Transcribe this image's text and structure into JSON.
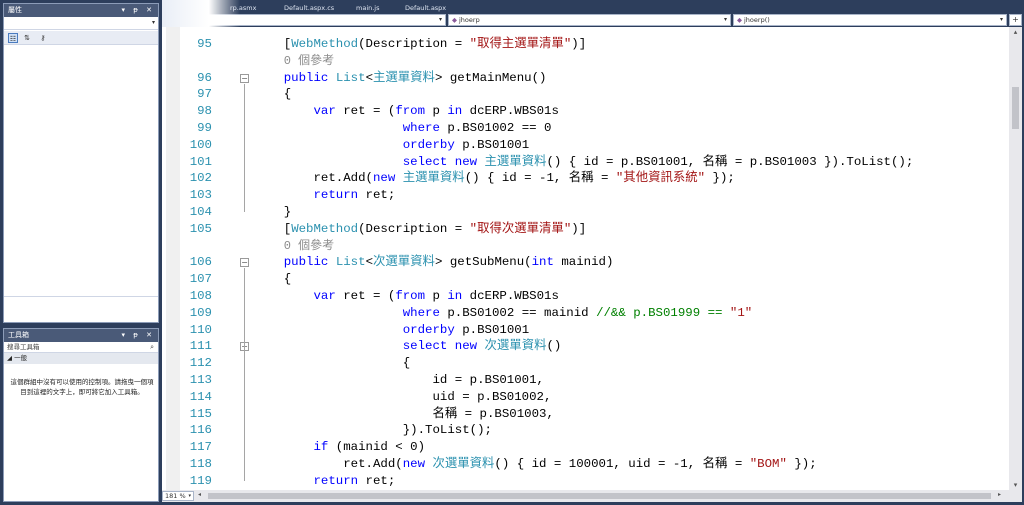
{
  "properties_panel": {
    "title": "屬性",
    "pin_buttons": "▾ ᵽ ✕",
    "toolbar": [
      "categorized-icon",
      "alphabetical-icon",
      "property-pages-icon"
    ]
  },
  "toolbox_panel": {
    "title": "工具箱",
    "pin_buttons": "▾ ᵽ ✕",
    "search_placeholder": "搜尋工具箱",
    "group_label": "◢ 一般",
    "empty_message": "這個群組中沒有可以使用的控制項。請拖曳一個項目到這裡的文字上，即可將它加入工具箱。"
  },
  "tabs": [
    "rp.asmx",
    "Default.aspx.cs",
    "main.js",
    "Default.aspx"
  ],
  "navbar": {
    "project_combo": "",
    "class_combo": "jhoerp",
    "member_combo": "jhoerp()"
  },
  "zoom": "181 %",
  "code_lines": [
    {
      "n": "95",
      "t": "    [<ty>WebMethod</ty>(Description = <str>\"取得主選單清單\"</str>)]"
    },
    {
      "n": "",
      "t": "    <lens>0 個參考</lens>"
    },
    {
      "n": "96",
      "t": "    <kw>public</kw> <ty>List</ty>&lt;<ty>主選單資料</ty>&gt; getMainMenu()"
    },
    {
      "n": "97",
      "t": "    {"
    },
    {
      "n": "98",
      "t": "        <kw>var</kw> ret = (<kw>from</kw> p <kw>in</kw> dcERP.WBS01s"
    },
    {
      "n": "99",
      "t": "                    <kw>where</kw> p.BS01002 == 0"
    },
    {
      "n": "100",
      "t": "                    <kw>orderby</kw> p.BS01001"
    },
    {
      "n": "101",
      "t": "                    <kw>select</kw> <kw>new</kw> <ty>主選單資料</ty>() { id = p.BS01001, 名稱 = p.BS01003 }).ToList();"
    },
    {
      "n": "102",
      "t": "        ret.Add(<kw>new</kw> <ty>主選單資料</ty>() { id = -1, 名稱 = <str>\"其他資訊系統\"</str> });"
    },
    {
      "n": "103",
      "t": "        <kw>return</kw> ret;"
    },
    {
      "n": "104",
      "t": "    }"
    },
    {
      "n": "105",
      "t": "    [<ty>WebMethod</ty>(Description = <str>\"取得次選單清單\"</str>)]"
    },
    {
      "n": "",
      "t": "    <lens>0 個參考</lens>"
    },
    {
      "n": "106",
      "t": "    <kw>public</kw> <ty>List</ty>&lt;<ty>次選單資料</ty>&gt; getSubMenu(<kw>int</kw> mainid)"
    },
    {
      "n": "107",
      "t": "    {"
    },
    {
      "n": "108",
      "t": "        <kw>var</kw> ret = (<kw>from</kw> p <kw>in</kw> dcERP.WBS01s"
    },
    {
      "n": "109",
      "t": "                    <kw>where</kw> p.BS01002 == mainid <cm>//&amp;&amp; p.BS01999 == </cm><str>\"1\"</str>"
    },
    {
      "n": "110",
      "t": "                    <kw>orderby</kw> p.BS01001"
    },
    {
      "n": "111",
      "t": "                    <kw>select</kw> <kw>new</kw> <ty>次選單資料</ty>()"
    },
    {
      "n": "112",
      "t": "                    {"
    },
    {
      "n": "113",
      "t": "                        id = p.BS01001,"
    },
    {
      "n": "114",
      "t": "                        uid = p.BS01002,"
    },
    {
      "n": "115",
      "t": "                        名稱 = p.BS01003,"
    },
    {
      "n": "116",
      "t": "                    }).ToList();"
    },
    {
      "n": "117",
      "t": "        <kw>if</kw> (mainid &lt; 0)"
    },
    {
      "n": "118",
      "t": "            ret.Add(<kw>new</kw> <ty>次選單資料</ty>() { id = 100001, uid = -1, 名稱 = <str>\"BOM\"</str> });"
    },
    {
      "n": "119",
      "t": "        <kw>return</kw> ret;"
    }
  ],
  "fold_markers": [
    2,
    13,
    18
  ],
  "colors": {
    "keyword": "#0000ff",
    "type": "#2b91af",
    "string": "#a31515",
    "comment": "#008000",
    "line_number": "#2b91af",
    "chrome": "#2d3e5c"
  }
}
